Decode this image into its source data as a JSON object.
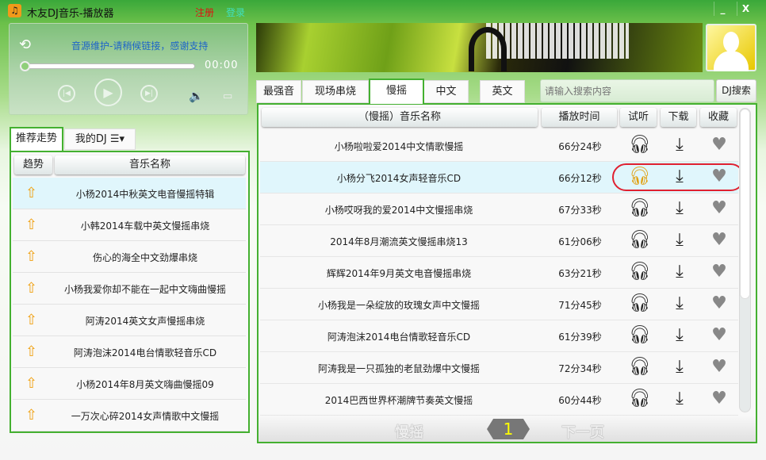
{
  "window": {
    "title": "木友DJ音乐-播放器",
    "register": "注册",
    "login": "登录",
    "minimize": "_",
    "close": "X"
  },
  "player": {
    "status": "音源维护-请稍候链接，感谢支持",
    "time": "00:00",
    "progress": 0
  },
  "left": {
    "tabs": [
      "推荐走势",
      "我的DJ"
    ],
    "menu_icon": "☰▾",
    "headers": {
      "trend": "趋势",
      "name": "音乐名称"
    },
    "items": [
      "小杨2014中秋英文电音慢摇特辑",
      "小韩2014车载中英文慢摇串烧",
      "伤心的海全中文劲爆串烧",
      "小杨我爱你却不能在一起中文嗨曲慢摇",
      "阿涛2014英文女声慢摇串烧",
      "阿涛泡沫2014电台情歌轻音乐CD",
      "小杨2014年8月英文嗨曲慢摇09",
      "一万次心碎2014女声情歌中文慢摇"
    ]
  },
  "right": {
    "tabs": [
      "最强音",
      "现场串烧",
      "慢摇",
      "中文",
      "英文"
    ],
    "active_tab": 2,
    "search": {
      "placeholder": "请输入搜索内容",
      "button": "DJ搜索"
    },
    "headers": {
      "name": "（慢摇）音乐名称",
      "duration": "播放时间",
      "listen": "试听",
      "download": "下载",
      "favorite": "收藏"
    },
    "rows": [
      {
        "name": "小杨啦啦爱2014中文情歌慢摇",
        "duration": "66分24秒"
      },
      {
        "name": "小杨分飞2014女声轻音乐CD",
        "duration": "66分12秒"
      },
      {
        "name": "小杨哎呀我的爱2014中文慢摇串烧",
        "duration": "67分33秒"
      },
      {
        "name": "2014年8月潮流英文慢摇串烧13",
        "duration": "61分06秒"
      },
      {
        "name": "辉辉2014年9月英文电音慢摇串烧",
        "duration": "63分21秒"
      },
      {
        "name": "小杨我是一朵绽放的玫瑰女声中文慢摇",
        "duration": "71分45秒"
      },
      {
        "name": "阿涛泡沫2014电台情歌轻音乐CD",
        "duration": "61分39秒"
      },
      {
        "name": "阿涛我是一只孤独的老鼠劲爆中文慢摇",
        "duration": "72分34秒"
      },
      {
        "name": "2014巴西世界杯潮牌节奏英文慢摇",
        "duration": "60分44秒"
      }
    ],
    "selected_row": 1,
    "footer": {
      "category": "慢摇",
      "page": "1",
      "next": "下一页"
    }
  },
  "colors": {
    "accent": "#44b030",
    "highlight": "#e02030",
    "listen_active": "#e0a010"
  }
}
